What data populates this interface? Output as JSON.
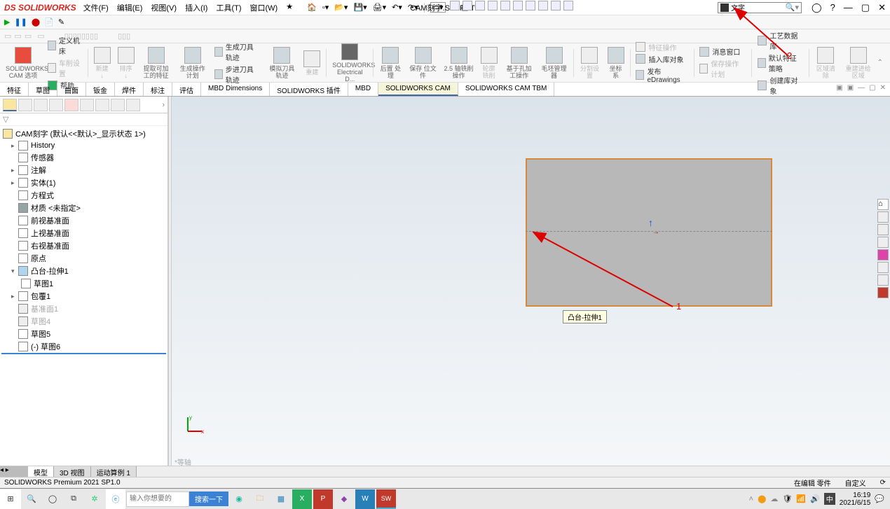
{
  "app_name": "SOLIDWORKS",
  "menu": {
    "file": "文件(F)",
    "edit": "编辑(E)",
    "view": "视图(V)",
    "insert": "插入(I)",
    "tool": "工具(T)",
    "window": "窗口(W)",
    "star": "★"
  },
  "doc_title": "CAM刻字.SLDPRT *",
  "search_placeholder": "文字",
  "ribbon": {
    "options": "SOLIDWORKS CAM 选项",
    "define_machine": "定义机床",
    "lathe_front": "车削设置",
    "help": "帮助",
    "extract_mach": "提取可加工的特征",
    "gen_op_plan": "生成操作计划",
    "gen_toolpath": "生成刀具轨迹",
    "step_toolpath": "步进刀具轨迹",
    "sim_toolpath": "模拟刀具轨迹",
    "save_file": "保存\n位文件",
    "electrical": "SOLIDWORKS Electrical D...",
    "postproc": "后置\n处理",
    "axis25": "2.5 轴铣削操作",
    "mill_op": "铣削",
    "hole_op": "基于孔加工操作",
    "blank": "毛坯管理器",
    "default_f": "分割设置",
    "coord": "坐标系",
    "feat_op": "特征操作",
    "publish_edraw": "发布 eDrawings",
    "msg_win": "消息窗口",
    "insert_lib": "插入库对象",
    "tech_db": "工艺数据库",
    "def_feat_strat": "默认特征策略",
    "create_lib": "创建库对象",
    "save_op": "保存操作计划",
    "area_clear": "区域清除",
    "rebuild": "重建进给区域"
  },
  "tabs": [
    "特征",
    "草图",
    "曲面",
    "钣金",
    "焊件",
    "标注",
    "评估",
    "MBD Dimensions",
    "SOLIDWORKS 插件",
    "MBD",
    "SOLIDWORKS CAM",
    "SOLIDWORKS CAM TBM"
  ],
  "active_tab": "SOLIDWORKS CAM",
  "tree": {
    "root": "CAM刻字 (默认<<默认>_显示状态 1>)",
    "history": "History",
    "sensor": "传感器",
    "annot": "注解",
    "solid": "实体(1)",
    "equations": "方程式",
    "material": "材质 <未指定>",
    "front": "前视基准面",
    "top": "上视基准面",
    "right": "右视基准面",
    "origin": "原点",
    "extrude": "凸台-拉伸1",
    "sketch1": "草图1",
    "wrap": "包覆1",
    "plane1": "基准面1",
    "sketch4": "草图4",
    "sketch5": "草图5",
    "sketch6": "(-) 草图6"
  },
  "tooltip": "凸台-拉伸1",
  "annotations": {
    "label1": "1",
    "label2": "2"
  },
  "faded": "*等轴",
  "bottom_tabs": [
    "模型",
    "3D 视图",
    "运动算例 1"
  ],
  "status_left": "SOLIDWORKS Premium 2021 SP1.0",
  "status_right1": "在编辑 零件",
  "status_right2": "自定义",
  "taskbar_search_ph": "输入你想要的",
  "taskbar_search_btn": "搜索一下",
  "clock_time": "16:19",
  "clock_date": "2021/6/15",
  "ime": "中"
}
